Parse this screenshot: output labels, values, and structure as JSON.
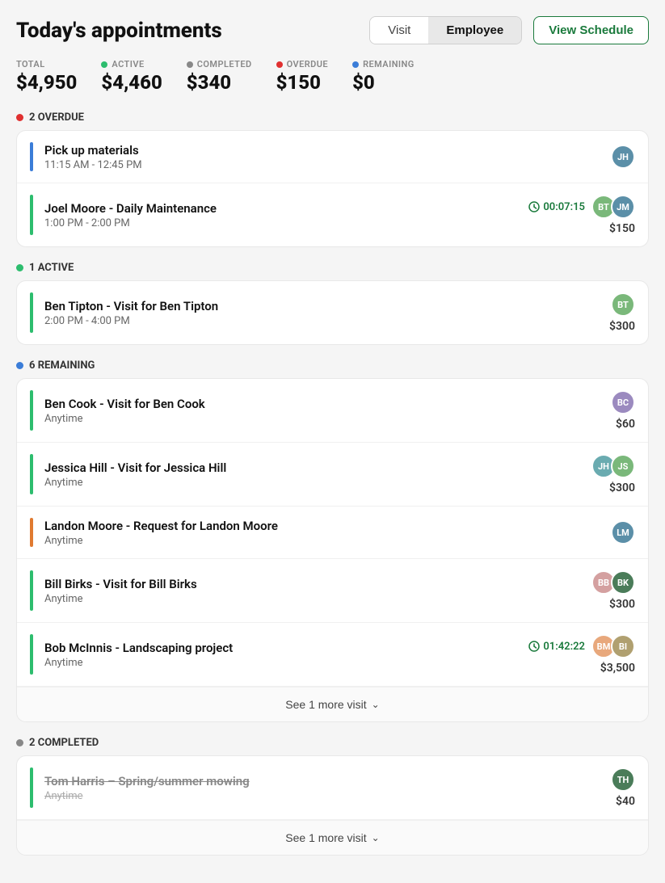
{
  "header": {
    "title": "Today's appointments",
    "tabs": [
      {
        "label": "Visit",
        "active": false
      },
      {
        "label": "Employee",
        "active": true
      }
    ],
    "view_schedule_label": "View Schedule"
  },
  "stats": [
    {
      "key": "total",
      "label": "TOTAL",
      "value": "$4,950",
      "dot_color": null
    },
    {
      "key": "active",
      "label": "ACTIVE",
      "value": "$4,460",
      "dot_color": "#2dbd6e"
    },
    {
      "key": "completed",
      "label": "COMPLETED",
      "value": "$340",
      "dot_color": "#888"
    },
    {
      "key": "overdue",
      "label": "OVERDUE",
      "value": "$150",
      "dot_color": "#e03030"
    },
    {
      "key": "remaining",
      "label": "REMAINING",
      "value": "$0",
      "dot_color": "#3b7dd8"
    }
  ],
  "sections": [
    {
      "key": "overdue",
      "label": "2 OVERDUE",
      "dot_color": "#e03030",
      "items": [
        {
          "title": "Pick up materials",
          "time": "11:15 AM - 12:45 PM",
          "bar_color": "bar-blue",
          "timer": null,
          "price": null,
          "avatars": [
            {
              "initials": "JH",
              "class": "avatar-1"
            }
          ],
          "strikethrough": false
        },
        {
          "title": "Joel Moore - Daily Maintenance",
          "time": "1:00 PM - 2:00 PM",
          "bar_color": "bar-green",
          "timer": "00:07:15",
          "price": "$150",
          "avatars": [
            {
              "initials": "BT",
              "class": "avatar-2"
            },
            {
              "initials": "JM",
              "class": "avatar-1"
            }
          ],
          "strikethrough": false
        }
      ],
      "see_more": null
    },
    {
      "key": "active",
      "label": "1 ACTIVE",
      "dot_color": "#2dbd6e",
      "items": [
        {
          "title": "Ben Tipton - Visit for Ben Tipton",
          "time": "2:00 PM - 4:00 PM",
          "bar_color": "bar-green",
          "timer": null,
          "price": "$300",
          "avatars": [
            {
              "initials": "BT",
              "class": "avatar-2"
            }
          ],
          "strikethrough": false
        }
      ],
      "see_more": null
    },
    {
      "key": "remaining",
      "label": "6 REMAINING",
      "dot_color": "#3b7dd8",
      "items": [
        {
          "title": "Ben Cook - Visit for Ben Cook",
          "time": "Anytime",
          "bar_color": "bar-green",
          "timer": null,
          "price": "$60",
          "avatars": [
            {
              "initials": "BC",
              "class": "avatar-4"
            }
          ],
          "strikethrough": false
        },
        {
          "title": "Jessica Hill - Visit for Jessica Hill",
          "time": "Anytime",
          "bar_color": "bar-green",
          "timer": null,
          "price": "$300",
          "avatars": [
            {
              "initials": "JH",
              "class": "avatar-6"
            },
            {
              "initials": "JS",
              "class": "avatar-2"
            }
          ],
          "strikethrough": false
        },
        {
          "title": "Landon Moore - Request for Landon Moore",
          "time": "Anytime",
          "bar_color": "bar-orange",
          "timer": null,
          "price": null,
          "avatars": [
            {
              "initials": "LM",
              "class": "avatar-1"
            }
          ],
          "strikethrough": false
        },
        {
          "title": "Bill Birks - Visit for Bill Birks",
          "time": "Anytime",
          "bar_color": "bar-green",
          "timer": null,
          "price": "$300",
          "avatars": [
            {
              "initials": "BB",
              "class": "avatar-5"
            },
            {
              "initials": "BK",
              "class": "avatar-8"
            }
          ],
          "strikethrough": false
        },
        {
          "title": "Bob McInnis - Landscaping project",
          "time": "Anytime",
          "bar_color": "bar-green",
          "timer": "01:42:22",
          "price": "$3,500",
          "avatars": [
            {
              "initials": "BM",
              "class": "avatar-3"
            },
            {
              "initials": "BI",
              "class": "avatar-7"
            }
          ],
          "strikethrough": false
        }
      ],
      "see_more": "See 1 more visit"
    },
    {
      "key": "completed",
      "label": "2 COMPLETED",
      "dot_color": "#888",
      "items": [
        {
          "title": "Tom Harris – Spring/summer mowing",
          "time": "Anytime",
          "bar_color": "bar-green",
          "timer": null,
          "price": "$40",
          "avatars": [
            {
              "initials": "TH",
              "class": "avatar-8"
            }
          ],
          "strikethrough": true
        }
      ],
      "see_more": "See 1 more visit"
    }
  ]
}
